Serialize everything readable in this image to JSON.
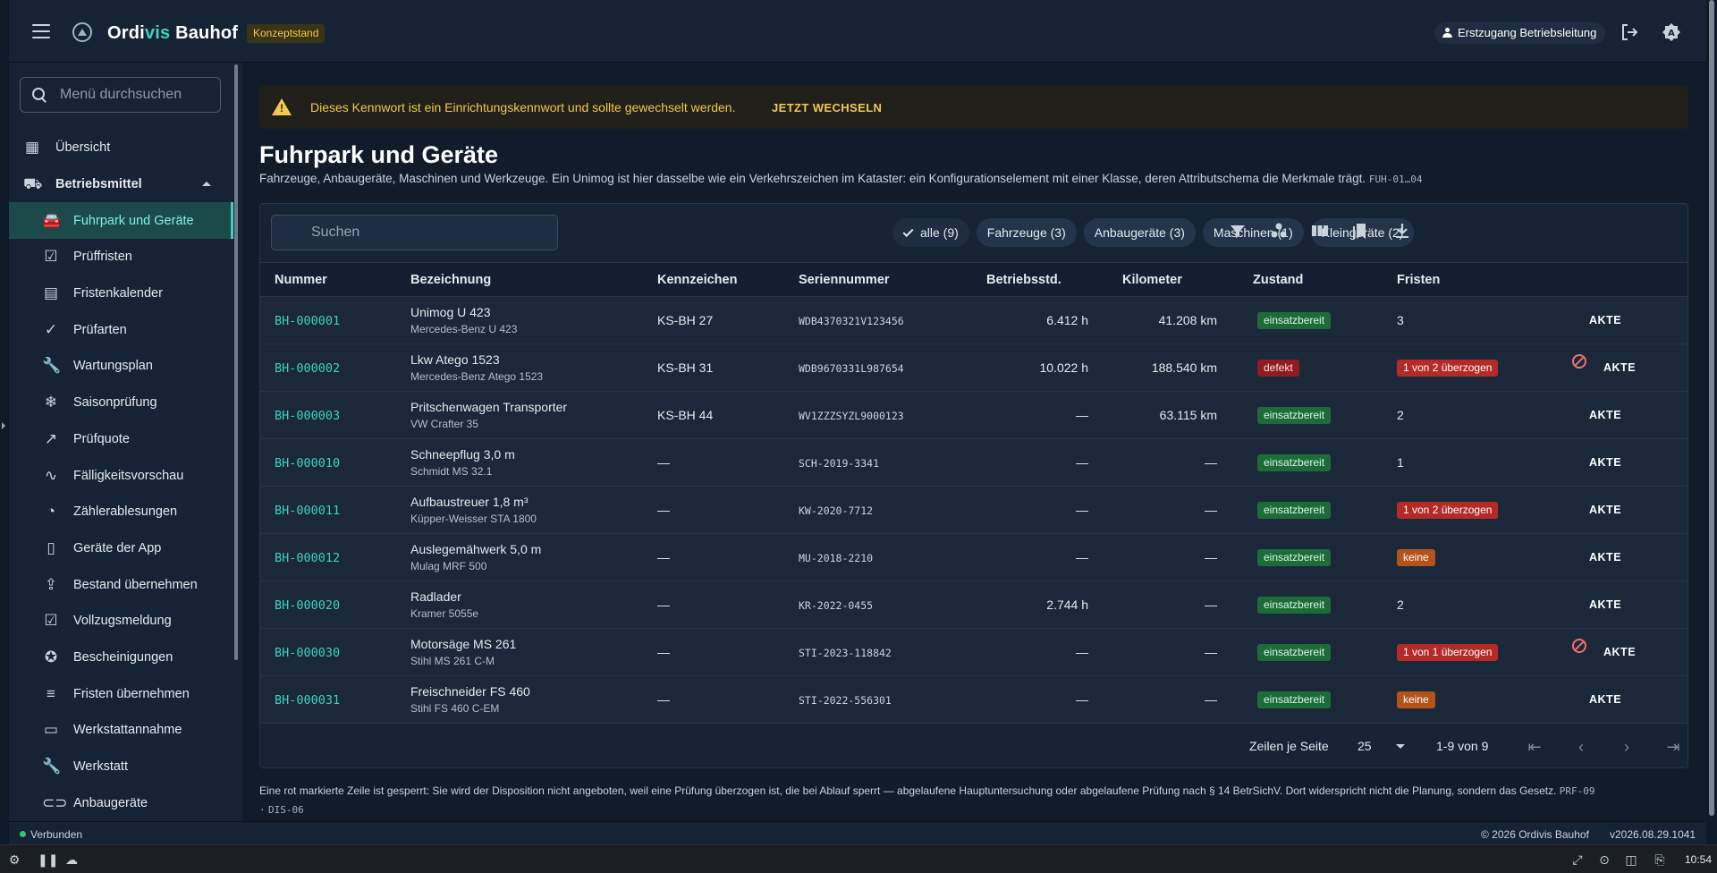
{
  "header": {
    "brand_part1": "Ordi",
    "brand_accent": "vis",
    "brand_part2": " Bauhof",
    "badge": "Konzeptstand",
    "user": "Erstzugang Betriebsleitung"
  },
  "sidebar": {
    "search_placeholder": "Menü durchsuchen",
    "items": [
      {
        "label": "Übersicht",
        "icon": "dashboard-icon",
        "glyph": "▦",
        "level": "top"
      },
      {
        "label": "Betriebsmittel",
        "icon": "truck-icon",
        "glyph": "⛟",
        "level": "group"
      },
      {
        "label": "Fuhrpark und Geräte",
        "icon": "car-icon",
        "glyph": "🚘",
        "level": "sub",
        "active": true
      },
      {
        "label": "Prüffristen",
        "icon": "calendar-check-icon",
        "glyph": "☑",
        "level": "sub"
      },
      {
        "label": "Fristenkalender",
        "icon": "calendar-icon",
        "glyph": "▤",
        "level": "sub"
      },
      {
        "label": "Prüfarten",
        "icon": "checklist-icon",
        "glyph": "✓",
        "level": "sub"
      },
      {
        "label": "Wartungsplan",
        "icon": "wrench-icon",
        "glyph": "🔧",
        "level": "sub"
      },
      {
        "label": "Saisonprüfung",
        "icon": "snowflake-icon",
        "glyph": "❄",
        "level": "sub"
      },
      {
        "label": "Prüfquote",
        "icon": "trend-icon",
        "glyph": "↗",
        "level": "sub"
      },
      {
        "label": "Fälligkeitsvorschau",
        "icon": "chart-line-icon",
        "glyph": "∿",
        "level": "sub"
      },
      {
        "label": "Zählerablesungen",
        "icon": "gauge-icon",
        "glyph": "◔",
        "level": "sub"
      },
      {
        "label": "Geräte der App",
        "icon": "phone-icon",
        "glyph": "▯",
        "level": "sub"
      },
      {
        "label": "Bestand übernehmen",
        "icon": "upload-file-icon",
        "glyph": "⇪",
        "level": "sub"
      },
      {
        "label": "Vollzugsmeldung",
        "icon": "clipboard-check-icon",
        "glyph": "☑",
        "level": "sub"
      },
      {
        "label": "Bescheinigungen",
        "icon": "certificate-icon",
        "glyph": "✪",
        "level": "sub"
      },
      {
        "label": "Fristen übernehmen",
        "icon": "list-check-icon",
        "glyph": "≡",
        "level": "sub"
      },
      {
        "label": "Werkstattannahme",
        "icon": "inbox-icon",
        "glyph": "▭",
        "level": "sub"
      },
      {
        "label": "Werkstatt",
        "icon": "wrench-icon",
        "glyph": "🔧",
        "level": "sub"
      },
      {
        "label": "Anbaugeräte",
        "icon": "link-icon",
        "glyph": "⊂⊃",
        "level": "sub"
      }
    ]
  },
  "warning": {
    "text": "Dieses Kennwort ist ein Einrichtungskennwort und sollte gewechselt werden.",
    "action": "JETZT WECHSELN"
  },
  "page": {
    "title": "Fuhrpark und Geräte",
    "subtitle": "Fahrzeuge, Anbaugeräte, Maschinen und Werkzeuge. Ein Unimog ist hier dasselbe wie ein Verkehrszeichen im Kataster: ein Konfigurationselement mit einer Klasse, deren Attributschema die Merkmale trägt.",
    "subtitle_code": "FUH-01…04"
  },
  "toolbar": {
    "search_placeholder": "Suchen",
    "chips": [
      {
        "label": "alle (9)",
        "selected": true
      },
      {
        "label": "Fahrzeuge (3)",
        "selected": false
      },
      {
        "label": "Anbaugeräte (3)",
        "selected": false
      },
      {
        "label": "Maschinen (1)",
        "selected": false
      },
      {
        "label": "Kleingeräte (2)",
        "selected": false
      }
    ]
  },
  "table": {
    "columns": {
      "nummer": "Nummer",
      "bezeichnung": "Bezeichnung",
      "kennzeichen": "Kennzeichen",
      "seriennummer": "Seriennummer",
      "betriebsstd": "Betriebsstd.",
      "kilometer": "Kilometer",
      "zustand": "Zustand",
      "fristen": "Fristen"
    },
    "action_label": "AKTE",
    "rows": [
      {
        "nummer": "BH-000001",
        "name": "Unimog U 423",
        "model": "Mercedes-Benz U 423",
        "kennzeichen": "KS-BH 27",
        "serial": "WDB4370321V123456",
        "hours": "6.412 h",
        "km": "41.208 km",
        "zustand": "einsatzbereit",
        "zustand_kind": "ok",
        "fristen": "3",
        "fristen_kind": "text",
        "blocked": false
      },
      {
        "nummer": "BH-000002",
        "name": "Lkw Atego 1523",
        "model": "Mercedes-Benz Atego 1523",
        "kennzeichen": "KS-BH 31",
        "serial": "WDB9670331L987654",
        "hours": "10.022 h",
        "km": "188.540 km",
        "zustand": "defekt",
        "zustand_kind": "bad",
        "fristen": "1 von 2 überzogen",
        "fristen_kind": "red",
        "blocked": true
      },
      {
        "nummer": "BH-000003",
        "name": "Pritschenwagen Transporter",
        "model": "VW Crafter 35",
        "kennzeichen": "KS-BH 44",
        "serial": "WV1ZZZSYZL9000123",
        "hours": "—",
        "km": "63.115 km",
        "zustand": "einsatzbereit",
        "zustand_kind": "ok",
        "fristen": "2",
        "fristen_kind": "text",
        "blocked": false
      },
      {
        "nummer": "BH-000010",
        "name": "Schneepflug 3,0 m",
        "model": "Schmidt MS 32.1",
        "kennzeichen": "—",
        "serial": "SCH-2019-3341",
        "hours": "—",
        "km": "—",
        "zustand": "einsatzbereit",
        "zustand_kind": "ok",
        "fristen": "1",
        "fristen_kind": "text",
        "blocked": false
      },
      {
        "nummer": "BH-000011",
        "name": "Aufbaustreuer 1,8 m³",
        "model": "Küpper-Weisser STA 1800",
        "kennzeichen": "—",
        "serial": "KW-2020-7712",
        "hours": "—",
        "km": "—",
        "zustand": "einsatzbereit",
        "zustand_kind": "ok",
        "fristen": "1 von 2 überzogen",
        "fristen_kind": "red",
        "blocked": false
      },
      {
        "nummer": "BH-000012",
        "name": "Auslegemähwerk 5,0 m",
        "model": "Mulag MRF 500",
        "kennzeichen": "—",
        "serial": "MU-2018-2210",
        "hours": "—",
        "km": "—",
        "zustand": "einsatzbereit",
        "zustand_kind": "ok",
        "fristen": "keine",
        "fristen_kind": "orange",
        "blocked": false
      },
      {
        "nummer": "BH-000020",
        "name": "Radlader",
        "model": "Kramer 5055e",
        "kennzeichen": "—",
        "serial": "KR-2022-0455",
        "hours": "2.744 h",
        "km": "—",
        "zustand": "einsatzbereit",
        "zustand_kind": "ok",
        "fristen": "2",
        "fristen_kind": "text",
        "blocked": false
      },
      {
        "nummer": "BH-000030",
        "name": "Motorsäge MS 261",
        "model": "Stihl MS 261 C-M",
        "kennzeichen": "—",
        "serial": "STI-2023-118842",
        "hours": "—",
        "km": "—",
        "zustand": "einsatzbereit",
        "zustand_kind": "ok",
        "fristen": "1 von 1 überzogen",
        "fristen_kind": "red",
        "blocked": true
      },
      {
        "nummer": "BH-000031",
        "name": "Freischneider FS 460",
        "model": "Stihl FS 460 C-EM",
        "kennzeichen": "—",
        "serial": "STI-2022-556301",
        "hours": "—",
        "km": "—",
        "zustand": "einsatzbereit",
        "zustand_kind": "ok",
        "fristen": "keine",
        "fristen_kind": "orange",
        "blocked": false
      }
    ]
  },
  "pagination": {
    "rows_label": "Zeilen je Seite",
    "rows_value": "25",
    "range": "1-9 von 9"
  },
  "footnote": {
    "text": "Eine rot markierte Zeile ist gesperrt: Sie wird der Disposition nicht angeboten, weil eine Prüfung überzogen ist, die bei Ablauf sperrt — abgelaufene Hauptuntersuchung oder abgelaufene Prüfung nach § 14 BetrSichV. Dort widerspricht nicht die Planung, sondern das Gesetz.",
    "code1": "PRF-09",
    "sep": "·",
    "code2": "DIS-06"
  },
  "status": {
    "connection": "Verbunden",
    "copyright": "© 2026 Ordivis Bauhof",
    "version": "v2026.08.29.1041"
  },
  "taskbar": {
    "time": "10:54"
  },
  "colors": {
    "accent": "#3fd0c0",
    "warning": "#f2c94c",
    "ok": "#1e6b3a",
    "defect": "#8e1c22",
    "overdue": "#b42a27",
    "none": "#b3521a"
  }
}
